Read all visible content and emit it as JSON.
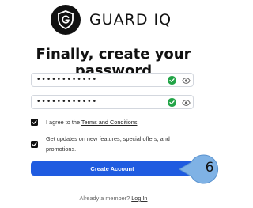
{
  "brand": {
    "name": "GUARD IQ",
    "logo_icon": "shield-g-logo"
  },
  "title": "Finally, create your password",
  "password_field": {
    "value": "••••••••••••",
    "status_icon": "check-circle-icon",
    "toggle_icon": "eye-icon"
  },
  "confirm_field": {
    "value": "••••••••••••",
    "status_icon": "check-circle-icon",
    "toggle_icon": "eye-icon"
  },
  "terms": {
    "checked": true,
    "prefix": "I agree to the ",
    "link": "Terms and Conditions"
  },
  "updates": {
    "checked": true,
    "label": "Get updates on new features, special offers, and promotions."
  },
  "submit": {
    "label": "Create Account"
  },
  "step_callout": {
    "number": "6"
  },
  "footer": {
    "prefix": "Already a member? ",
    "link": "Log In"
  },
  "colors": {
    "accent": "#1f5be0",
    "success": "#22a447",
    "callout": "#7fb2e5"
  }
}
